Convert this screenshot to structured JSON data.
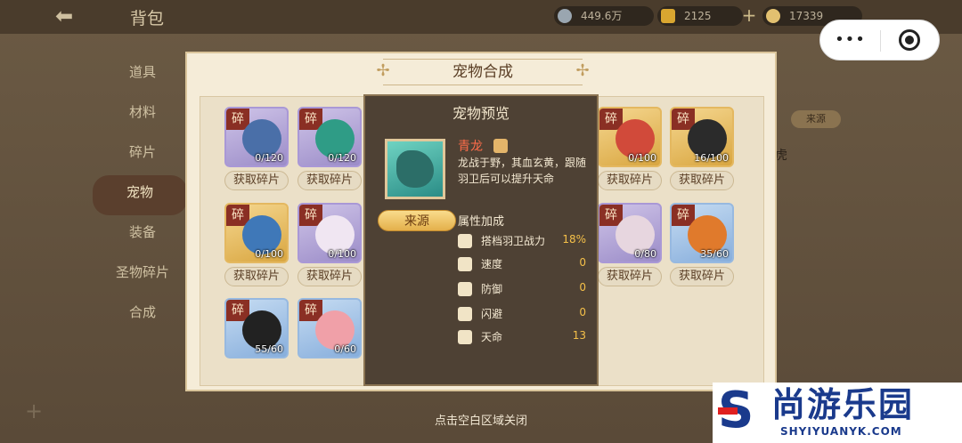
{
  "header": {
    "back_icon": "back-arrow-icon",
    "title": "背包",
    "resources": [
      {
        "icon": "silver-coin-icon",
        "value": "449.6万"
      },
      {
        "icon": "gold-ingot-icon",
        "value": "2125"
      },
      {
        "icon": "yuanbao-icon",
        "value": "17339"
      }
    ]
  },
  "miniprogram": {
    "more": "•••"
  },
  "side_menu": {
    "items": [
      {
        "label": "道具"
      },
      {
        "label": "材料"
      },
      {
        "label": "碎片"
      },
      {
        "label": "宠物",
        "active": true
      },
      {
        "label": "装备"
      },
      {
        "label": "圣物碎片"
      },
      {
        "label": "合成"
      }
    ]
  },
  "background": {
    "source_tag": "来源",
    "side_text": "虎"
  },
  "panel": {
    "title": "宠物合成",
    "fragment_char": "碎",
    "get_label": "获取碎片",
    "cards": [
      {
        "count": "0/120",
        "frame": "purple",
        "color": "#4a6fa8"
      },
      {
        "count": "0/120",
        "frame": "purple",
        "color": "#2f9c86"
      },
      {
        "count": "0/100",
        "frame": "gold",
        "color": "#d14a3a"
      },
      {
        "count": "16/100",
        "frame": "gold",
        "color": "#2b2b2b"
      },
      {
        "count": "0/100",
        "frame": "gold",
        "color": "#3f78b8"
      },
      {
        "count": "0/100",
        "frame": "purple",
        "color": "#f0e6f2"
      },
      {
        "count": "0/80",
        "frame": "purple",
        "color": "#e7d6df"
      },
      {
        "count": "35/60",
        "frame": "blue",
        "color": "#e07a2c"
      },
      {
        "count": "55/60",
        "frame": "blue",
        "color": "#222222"
      },
      {
        "count": "0/60",
        "frame": "blue",
        "color": "#f0a0a8"
      }
    ]
  },
  "preview": {
    "title": "宠物预览",
    "name": "青龙",
    "description": "龙战于野，其血玄黄，跟随羽卫后可以提升天命",
    "source_button": "来源",
    "attr_header": "属性加成",
    "attributes": [
      {
        "icon": "feather-icon",
        "name": "搭档羽卫战力",
        "value": "18%"
      },
      {
        "icon": "boot-icon",
        "name": "速度",
        "value": "0"
      },
      {
        "icon": "shield-icon",
        "name": "防御",
        "value": "0"
      },
      {
        "icon": "dodge-icon",
        "name": "闪避",
        "value": "0"
      },
      {
        "icon": "mountain-icon",
        "name": "天命",
        "value": "13"
      }
    ]
  },
  "close_hint": "点击空白区域关闭",
  "watermark": {
    "brand_cn": "尚游乐园",
    "brand_en": "SHYIYUANYK.COM"
  }
}
